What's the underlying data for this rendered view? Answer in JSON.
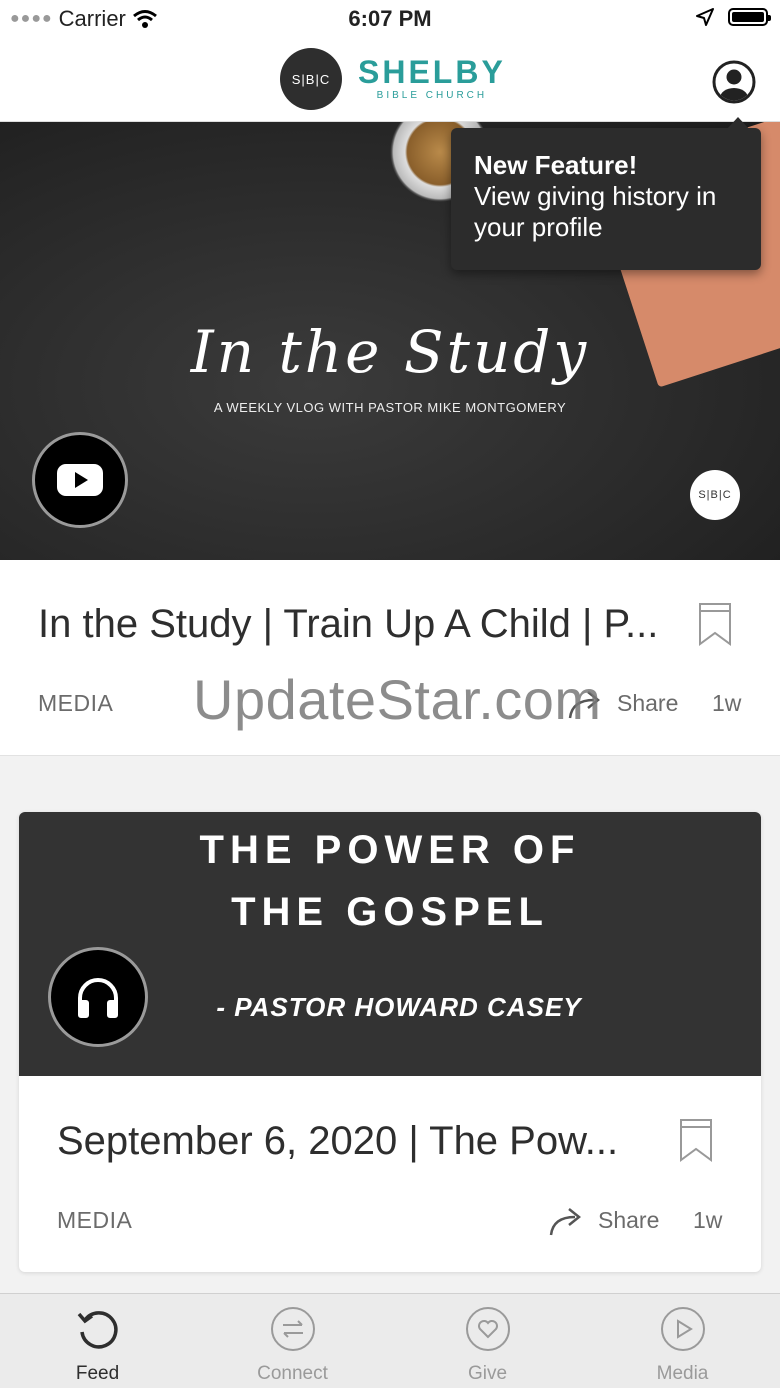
{
  "status_bar": {
    "carrier": "Carrier",
    "time": "6:07 PM"
  },
  "header": {
    "logo_mark": "S|B|C",
    "brand_name": "SHELBY",
    "brand_sub": "BIBLE CHURCH",
    "accent_color": "#2a9d9a"
  },
  "tooltip": {
    "title": "New Feature!",
    "body": "View giving history in your profile"
  },
  "feed": {
    "items": [
      {
        "hero_title": "In the Study",
        "hero_subtitle": "A WEEKLY VLOG WITH PASTOR MIKE MONTGOMERY",
        "badge_text": "S|B|C",
        "media_icon": "youtube-icon",
        "title": "In the Study | Train Up A Child | P...",
        "category": "MEDIA",
        "share_label": "Share",
        "age": "1w"
      },
      {
        "hero_line1": "THE POWER OF",
        "hero_line2": "THE GOSPEL",
        "hero_author": "- PASTOR HOWARD CASEY",
        "media_icon": "headphones-icon",
        "title": "September 6, 2020 | The Pow...",
        "category": "MEDIA",
        "share_label": "Share",
        "age": "1w"
      }
    ]
  },
  "watermark": "UpdateStar.com",
  "tabs": [
    {
      "label": "Feed",
      "icon": "feed-refresh-icon",
      "active": true
    },
    {
      "label": "Connect",
      "icon": "connect-arrows-icon",
      "active": false
    },
    {
      "label": "Give",
      "icon": "give-heart-icon",
      "active": false
    },
    {
      "label": "Media",
      "icon": "media-play-icon",
      "active": false
    }
  ]
}
